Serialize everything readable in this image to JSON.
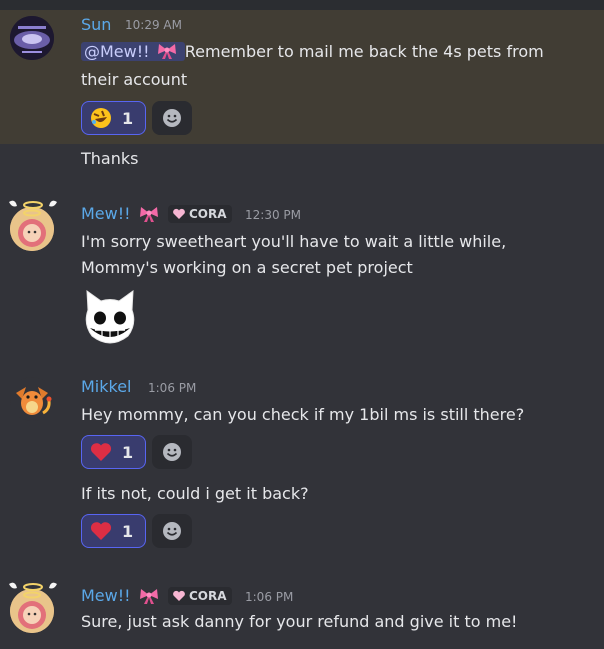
{
  "messages": {
    "sun": {
      "author": "Sun",
      "time": "10:29 AM",
      "mention": "@Mew!!",
      "line1": " Remember to mail me back the 4s pets from",
      "line2": "their account",
      "reaction": {
        "emoji": "rolling-on-floor-laughing",
        "count": "1"
      },
      "followup": "Thanks"
    },
    "mew1": {
      "author": "Mew!!",
      "tag": "CORA",
      "time": "12:30 PM",
      "line1": "I'm sorry sweetheart you'll have to wait a little while,",
      "line2": "Mommy's working on a secret pet project",
      "sticker": "grinning-cat-sticker"
    },
    "mikkel": {
      "author": "Mikkel",
      "time": "1:06 PM",
      "line1": "Hey mommy, can you check if my 1bil ms is still there?",
      "reaction1": {
        "emoji": "red-heart",
        "count": "1"
      },
      "followup": "If its not, could i get it back?",
      "reaction2": {
        "emoji": "red-heart",
        "count": "1"
      }
    },
    "mew2": {
      "author": "Mew!!",
      "tag": "CORA",
      "time": "1:06 PM",
      "line1": "Sure, just ask danny for your refund and give it to me!"
    }
  },
  "colors": {
    "background": "#323339",
    "highlight": "#413d34",
    "username": "#5ba8e8",
    "reaction_selected_border": "#5865f2"
  }
}
